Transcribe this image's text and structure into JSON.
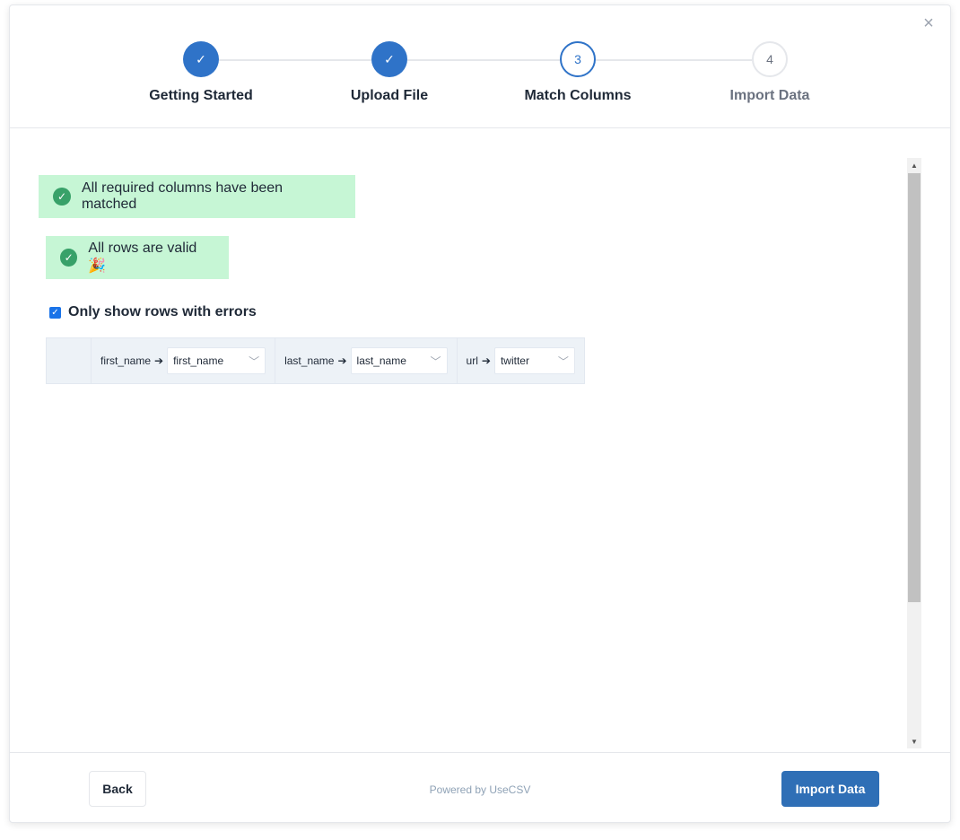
{
  "steps": [
    {
      "label": "Getting Started",
      "marker": "✓",
      "state": "done"
    },
    {
      "label": "Upload File",
      "marker": "✓",
      "state": "done"
    },
    {
      "label": "Match Columns",
      "marker": "3",
      "state": "current"
    },
    {
      "label": "Import Data",
      "marker": "4",
      "state": "future"
    }
  ],
  "close_icon": "×",
  "alerts": {
    "required": "All required columns have been matched",
    "rows": "All rows are valid 🎉"
  },
  "filter": {
    "label": "Only show rows with errors",
    "checked": true
  },
  "columns": [
    {
      "source": "first_name",
      "target": "first_name"
    },
    {
      "source": "last_name",
      "target": "last_name"
    },
    {
      "source": "url",
      "target": "twitter"
    }
  ],
  "footer": {
    "back_label": "Back",
    "powered_by": "Powered by UseCSV",
    "import_label": "Import Data"
  },
  "colors": {
    "accent": "#2f73c8",
    "success_bg": "#c6f6d5",
    "success_icon": "#38a169"
  }
}
